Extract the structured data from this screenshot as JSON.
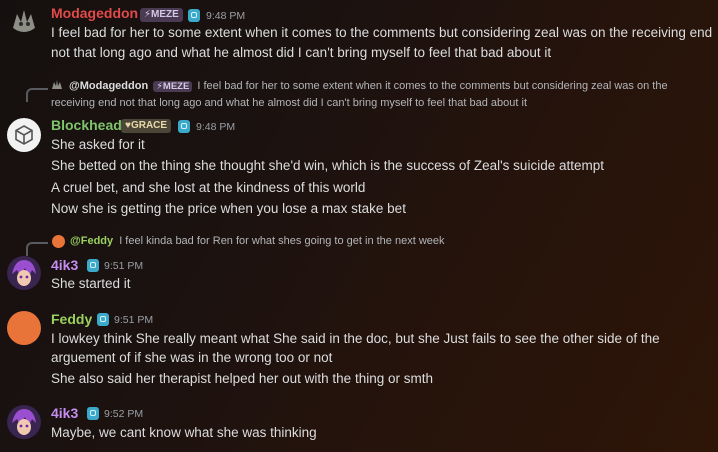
{
  "messages": [
    {
      "author": "Modageddon",
      "author_color": "#e24a4a",
      "tag": "⚡MEZE",
      "time": "9:48 PM",
      "lines": [
        "I feel bad for her to some extent when it comes to the comments but considering zeal was on the receiving end",
        "not that long ago and what he almost did I can't bring myself to feel that bad about it"
      ]
    },
    {
      "reply": {
        "name": "@Modageddon",
        "tag": "⚡MEZE",
        "text_line1": "I feel bad for her to some extent when it comes to the comments but considering zeal was on the",
        "text_line2": "receiving end not that long ago and what he almost did I can't bring myself to feel that bad about it"
      },
      "author": "Blockhead",
      "author_color": "#7fc46b",
      "tag": "♥GRACE",
      "time": "9:48 PM",
      "lines": [
        "She asked for it",
        "She betted on the thing she thought she'd win, which is the success of Zeal's suicide attempt",
        "A cruel bet, and she lost at the kindness of this world",
        "Now she is getting the price when you lose a max stake bet"
      ]
    },
    {
      "reply": {
        "name": "@Feddy",
        "text_line1": "I feel kinda bad for Ren for what shes going to get in the next week"
      },
      "author": "4ik3",
      "author_color": "#c58df0",
      "time": "9:51 PM",
      "lines": [
        "She started it"
      ]
    },
    {
      "author": "Feddy",
      "author_color": "#9ad15e",
      "time": "9:51 PM",
      "lines": [
        "I lowkey think She really meant what She said in the doc, but she Just fails to see the other side of the",
        "arguement of if she was in the wrong too or not",
        "She also said her therapist helped her out with the thing or smth"
      ]
    },
    {
      "author": "4ik3",
      "author_color": "#c58df0",
      "time": "9:52 PM",
      "lines": [
        "Maybe, we cant know what she was thinking"
      ]
    }
  ]
}
